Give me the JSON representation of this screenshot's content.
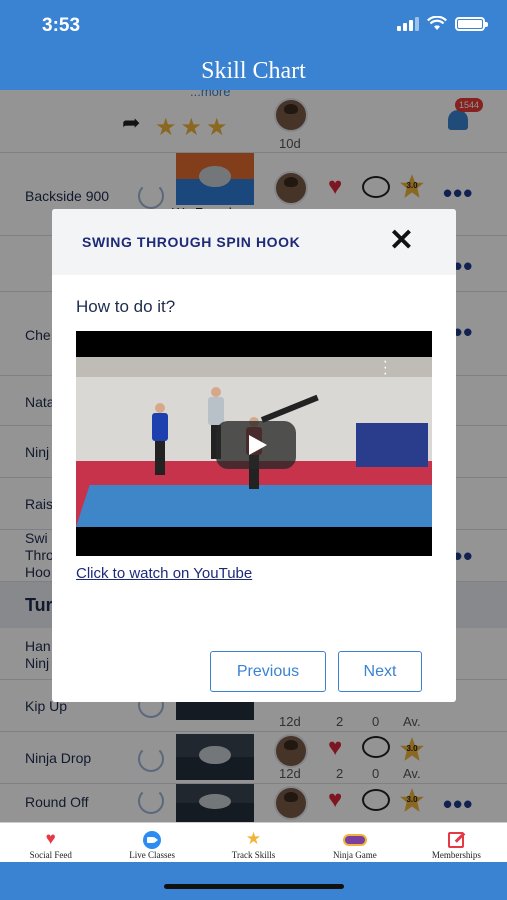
{
  "status_bar": {
    "time": "3:53"
  },
  "header": {
    "title": "Skill Chart"
  },
  "list": {
    "more_link": "...more",
    "top_row": {
      "days": "10d",
      "bell_badge": "1544"
    },
    "rows": [
      {
        "label": "Backside 900",
        "thumb_caption": "We Found a",
        "rating": "3.0"
      },
      {
        "label": ""
      },
      {
        "label": "Che"
      },
      {
        "label": "Nata"
      },
      {
        "label": "Ninj"
      },
      {
        "label": "Rais"
      },
      {
        "label": "Swi\nThro\nHoo"
      }
    ],
    "section_header": "Tur",
    "lower_rows": [
      {
        "label": "Han\nNinj"
      },
      {
        "label": "Kip Up",
        "days": "12d",
        "likes": "2",
        "comments": "0",
        "rating_text": "Av."
      },
      {
        "label": "Ninja Drop",
        "days": "12d",
        "likes": "2",
        "comments": "0",
        "rating_text": "Av.",
        "rating": "3.0"
      },
      {
        "label": "Round Off",
        "rating": "3.0"
      }
    ]
  },
  "modal": {
    "title": "SWING THROUGH SPIN HOOK",
    "close_icon": "close-icon",
    "question": "How to do it?",
    "video_link": "Click to watch on YouTube",
    "previous_label": "Previous",
    "next_label": "Next"
  },
  "tab_bar": {
    "tabs": [
      {
        "label": "Social Feed",
        "icon": "heart-icon",
        "color": "#e53946"
      },
      {
        "label": "Live Classes",
        "icon": "video-icon",
        "color": "#2d8cf0"
      },
      {
        "label": "Track Skills",
        "icon": "star-icon",
        "color": "#f0b43a"
      },
      {
        "label": "Ninja Game",
        "icon": "ninja-game-icon",
        "color": "#7b3fa0"
      },
      {
        "label": "Memberships",
        "icon": "edit-icon",
        "color": "#e53946"
      }
    ]
  },
  "colors": {
    "brand": "#3a83d2",
    "modal_title": "#1e2a78"
  }
}
